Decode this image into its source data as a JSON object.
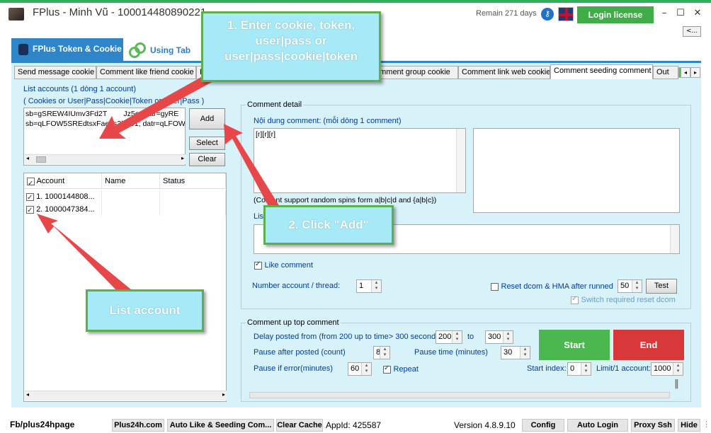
{
  "window": {
    "title": "FPlus - Minh Vũ - 100014480890221",
    "remain": "Remain 271 days",
    "login_license": "Login license",
    "minimize": "–",
    "maximize": "☐",
    "close": "✕",
    "collapse": "<..."
  },
  "main_tabs": [
    {
      "label": "FPlus Token & Cookie"
    },
    {
      "label": "Using Tab"
    }
  ],
  "sub_tabs": [
    "Send message cookie",
    "Comment like friend cookie",
    "F",
    "omment group cookie",
    "Comment link web cookie",
    "Comment seeding comment",
    "Out"
  ],
  "accounts_panel": {
    "title": "List accounts (1 dòng 1 account)",
    "hint": "( Cookies or User|Pass|Cookie|Token or User|Pass )",
    "input_lines": [
      "sb=gSREW4IUmv3Fd2T        Jz5o; datr=gyRE",
      "sb=qLFOW5SREdtsxFae6s3k1iJ1; datr=qLFOW"
    ],
    "add_button": "Add",
    "select_button": "Select",
    "clear_button": "Clear"
  },
  "account_grid": {
    "columns": [
      "Account",
      "Name",
      "Status"
    ],
    "rows": [
      {
        "account": "1. 1000144808...",
        "name": "",
        "status": ""
      },
      {
        "account": "2. 1000047384...",
        "name": "",
        "status": ""
      }
    ]
  },
  "comment_detail": {
    "group_title": "Comment detail",
    "content_label": "Nội dung comment: (mỗi dòng 1 comment)",
    "content_value": "[r][r][r]",
    "spin_note": "(Content support random spins form a|b|c|d and {a|b|c})",
    "list_label": "Lis",
    "like_comment": "Like comment",
    "number_account_label": "Number account / thread:",
    "number_account_value": "1",
    "reset_label": "Reset dcom & HMA after runned",
    "reset_value": "50",
    "test_button": "Test",
    "switch_label": "Switch required reset dcom"
  },
  "up_top": {
    "group_title": "Comment up top comment",
    "delay_label": "Delay posted from (from 200 up to time> 300 seconds)",
    "delay_from": "200",
    "to_label": "to",
    "delay_to": "300",
    "pause_after_label": "Pause after posted (count)",
    "pause_after_value": "8",
    "pause_time_label": "Pause time (minutes)",
    "pause_time_value": "30",
    "pause_error_label": "Pause if error(minutes)",
    "pause_error_value": "60",
    "repeat_label": "Repeat",
    "start_index_label": "Start index:",
    "start_index_value": "0",
    "limit_label": "Limit/1 account:",
    "limit_value": "1000",
    "start_button": "Start",
    "end_button": "End"
  },
  "status_bar": {
    "page": "Fb/plus24hpage",
    "btn_site": "Plus24h.com",
    "btn_auto": "Auto Like & Seeding Com...",
    "btn_cache": "Clear Cache",
    "appid": "AppId: 425587",
    "version": "Version 4.8.9.10",
    "btn_config": "Config",
    "btn_autologin": "Auto Login",
    "btn_proxy": "Proxy Ssh",
    "btn_hide": "Hide"
  },
  "callouts": {
    "step1": "1. Enter cookie, token, user|pass or user|pass|cookie|token",
    "step2": "2. Click \"Add\"",
    "list": "List account"
  },
  "colors": {
    "accent_blue": "#2e86c8",
    "panel_bg": "#d8f2fa",
    "start_green": "#4ab84f",
    "end_red": "#d9383a",
    "arrow_red": "#e8474a",
    "callout_bg": "#a6e9f7",
    "callout_border": "#5cb04c"
  }
}
